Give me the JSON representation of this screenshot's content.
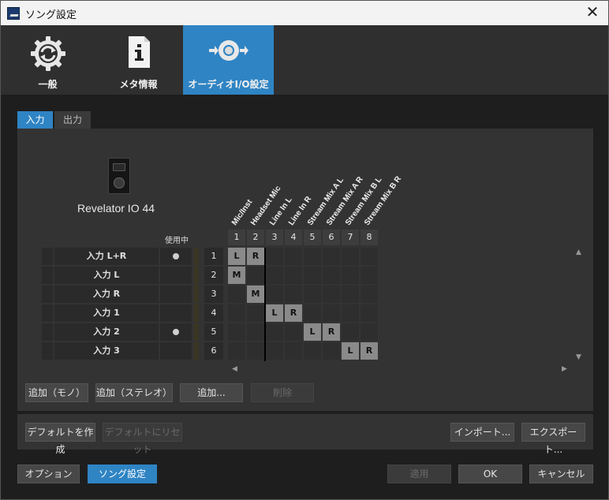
{
  "window": {
    "title": "ソング設定",
    "close_glyph": "✕"
  },
  "tabs": [
    {
      "label": "一般",
      "icon": "gear-refresh-icon",
      "active": false
    },
    {
      "label": "メタ情報",
      "icon": "info-document-icon",
      "active": false
    },
    {
      "label": "オーディオI/O設定",
      "icon": "audio-io-icon",
      "active": true
    }
  ],
  "subtabs": {
    "input": "入力",
    "output": "出力"
  },
  "device": {
    "name": "Revelator IO 44"
  },
  "routing": {
    "in_use_header": "使用中",
    "columns": [
      {
        "num": "1",
        "label": "Mic/Inst"
      },
      {
        "num": "2",
        "label": "Headset Mic"
      },
      {
        "num": "3",
        "label": "Line In L"
      },
      {
        "num": "4",
        "label": "Line In R"
      },
      {
        "num": "5",
        "label": "Stream Mix A L"
      },
      {
        "num": "6",
        "label": "Stream Mix A R"
      },
      {
        "num": "7",
        "label": "Stream Mix B L"
      },
      {
        "num": "8",
        "label": "Stream Mix B R"
      }
    ],
    "rows": [
      {
        "name": "入力 L+R",
        "in_use": true,
        "num": "1",
        "cells": [
          "L",
          "R",
          "",
          "",
          "",
          "",
          "",
          ""
        ]
      },
      {
        "name": "入力 L",
        "in_use": false,
        "num": "2",
        "cells": [
          "M",
          "",
          "",
          "",
          "",
          "",
          "",
          ""
        ]
      },
      {
        "name": "入力 R",
        "in_use": false,
        "num": "3",
        "cells": [
          "",
          "M",
          "",
          "",
          "",
          "",
          "",
          ""
        ]
      },
      {
        "name": "入力 1",
        "in_use": false,
        "num": "4",
        "cells": [
          "",
          "",
          "L",
          "R",
          "",
          "",
          "",
          ""
        ]
      },
      {
        "name": "入力 2",
        "in_use": true,
        "num": "5",
        "cells": [
          "",
          "",
          "",
          "",
          "L",
          "R",
          "",
          ""
        ]
      },
      {
        "name": "入力 3",
        "in_use": false,
        "num": "6",
        "cells": [
          "",
          "",
          "",
          "",
          "",
          "",
          "L",
          "R"
        ]
      }
    ]
  },
  "buttons": {
    "add_mono": "追加（モノ）",
    "add_stereo": "追加（ステレオ）",
    "add": "追加...",
    "remove": "削除",
    "make_default": "デフォルトを作成",
    "reset_default": "デフォルトにリセット",
    "import": "インポート...",
    "export": "エクスポート...",
    "options": "オプション",
    "song_settings": "ソング設定",
    "apply": "適用",
    "ok": "OK",
    "cancel": "キャンセル"
  },
  "colors": {
    "accent": "#2f84c4",
    "background": "#1e1e1e",
    "panel": "#333333",
    "active_cell": "#8a8a8a"
  }
}
